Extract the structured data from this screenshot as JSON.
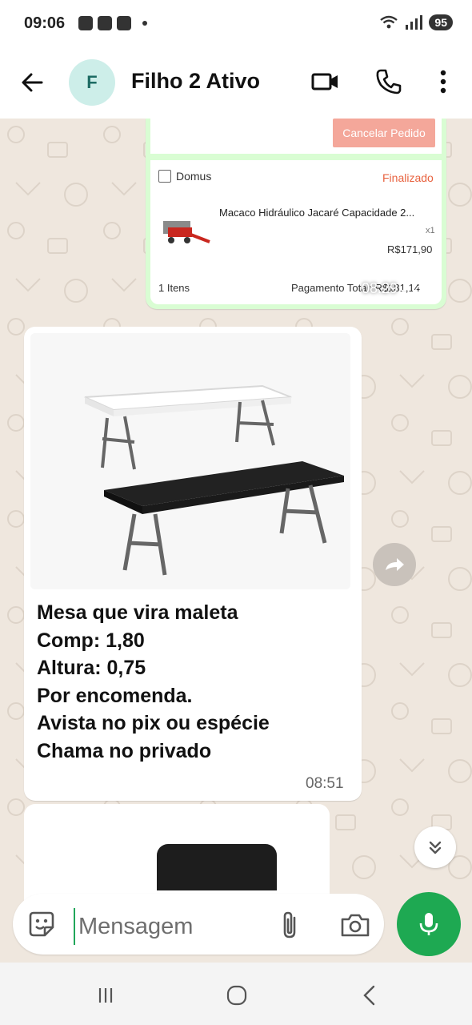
{
  "status_bar": {
    "time": "09:06",
    "battery": "95"
  },
  "header": {
    "avatar_letter": "F",
    "title": "Filho 2 Ativo"
  },
  "order_card": {
    "cancel_label": "Cancelar Pedido",
    "store": "Domus",
    "state": "Finalizado",
    "product_name": "Macaco Hidráulico Jacaré Capacidade 2...",
    "quantity": "x1",
    "price": "R$171,90",
    "items": "1 Itens",
    "total": "Pagamento Total: R$181,14",
    "time": "08:29"
  },
  "message": {
    "text": "Mesa que vira maleta\nComp: 1,80\nAltura: 0,75\nPor encomenda.\nAvista no pix ou espécie\nChama no privado",
    "time": "08:51"
  },
  "composer": {
    "placeholder": "Mensagem"
  },
  "colors": {
    "accent": "#1ea952",
    "chat_bg": "#efe7de",
    "own_bubble": "#d9fdd3",
    "cancel_button": "#f4a79a",
    "status_finalizado": "#e8623f"
  },
  "icons": {
    "back": "arrow-left-icon",
    "video": "video-call-icon",
    "phone": "phone-icon",
    "menu": "more-vert-icon",
    "sticker": "sticker-icon",
    "attach": "paperclip-icon",
    "camera": "camera-icon",
    "mic": "microphone-icon",
    "forward": "forward-icon",
    "scroll": "chevrons-down-icon"
  }
}
